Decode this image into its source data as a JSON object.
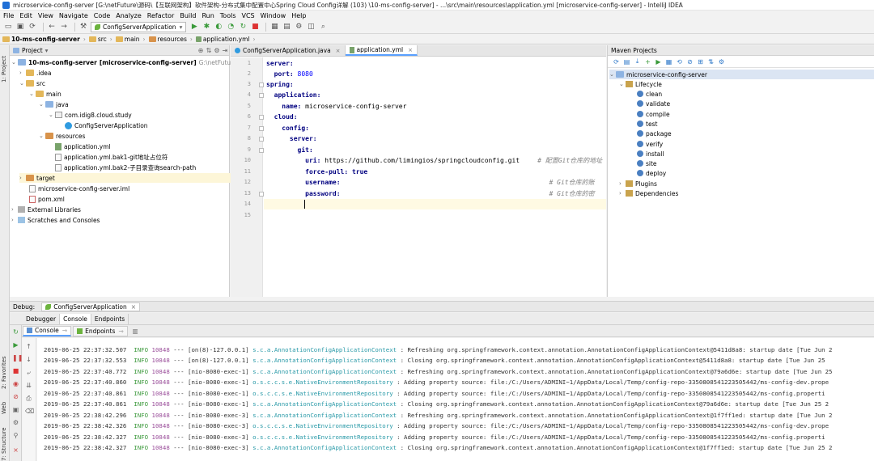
{
  "window": {
    "title": "microservice-config-server [G:\\netFuture\\源码\\【互联网架构】软件架构-分布式集中配置中心Spring Cloud Config详解 (103) \\10-ms-config-server] - ...\\src\\main\\resources\\application.yml [microservice-config-server] - IntelliJ IDEA"
  },
  "menu": [
    "File",
    "Edit",
    "View",
    "Navigate",
    "Code",
    "Analyze",
    "Refactor",
    "Build",
    "Run",
    "Tools",
    "VCS",
    "Window",
    "Help"
  ],
  "toolbar": {
    "run_config": "ConfigServerApplication"
  },
  "breadcrumb": [
    "10-ms-config-server",
    "src",
    "main",
    "resources",
    "application.yml"
  ],
  "left_strip": {
    "project_tab": "1: Project",
    "favorites_tab": "2: Favorites",
    "web_tab": "Web",
    "structure_tab": "7: Structure"
  },
  "project": {
    "title": "Project",
    "root_name": "10-ms-config-server",
    "root_module": "[microservice-config-server]",
    "root_path": "G:\\netFuture\\源码\\【互",
    "tree": {
      "idea": ".idea",
      "src": "src",
      "main": "main",
      "java": "java",
      "package": "com.idig8.cloud.study",
      "class": "ConfigServerApplication",
      "resources": "resources",
      "yml": "application.yml",
      "bak1": "application.yml.bak1-git地址占位符",
      "bak2": "application.yml.bak2-子目录查询search-path",
      "target": "target",
      "iml": "microservice-config-server.iml",
      "pom": "pom.xml",
      "libs": "External Libraries",
      "scratches": "Scratches and Consoles"
    }
  },
  "editor": {
    "tabs": [
      {
        "label": "ConfigServerApplication.java"
      },
      {
        "label": "application.yml"
      }
    ],
    "line_numbers": [
      "1",
      "2",
      "3",
      "4",
      "5",
      "6",
      "7",
      "8",
      "9",
      "10",
      "11",
      "12",
      "13",
      "14",
      "15"
    ],
    "code": {
      "l1": "server:",
      "l2k": "  port: ",
      "l2v": "8080",
      "l3": "spring:",
      "l4": "  application:",
      "l5k": "    name: ",
      "l5v": "microservice-config-server",
      "l6": "  cloud:",
      "l7": "    config:",
      "l8": "      server:",
      "l9": "        git:",
      "l10k": "          uri: ",
      "l10v": "https://github.com/limingios/springcloudconfig.git",
      "l10c": "# 配置Git仓库的地址",
      "l11k": "          force-pull: ",
      "l11v": "true",
      "l12k": "          username:",
      "l12c": "# Git仓库的账",
      "l13k": "          password:",
      "l13c": "# Git仓库的密"
    }
  },
  "maven": {
    "title": "Maven Projects",
    "project": "microservice-config-server",
    "lifecycle": "Lifecycle",
    "goals": [
      "clean",
      "validate",
      "compile",
      "test",
      "package",
      "verify",
      "install",
      "site",
      "deploy"
    ],
    "plugins": "Plugins",
    "dependencies": "Dependencies"
  },
  "debug": {
    "label": "Debug:",
    "session": "ConfigServerApplication",
    "subtabs": [
      "Debugger",
      "Console",
      "Endpoints"
    ],
    "console_tabs": [
      "Console",
      "Endpoints"
    ]
  },
  "logs": [
    {
      "ts": "2019-06-25 22:37:32.507",
      "lvl": "INFO",
      "pid": "10848",
      "thr": "--- [on(8)-127.0.0.1]",
      "cls": "s.c.a.AnnotationConfigApplicationContext",
      "msg": ": Refreshing org.springframework.context.annotation.AnnotationConfigApplicationContext@5411d8a8: startup date [Tue Jun 2"
    },
    {
      "ts": "2019-06-25 22:37:32.553",
      "lvl": "INFO",
      "pid": "10848",
      "thr": "--- [on(8)-127.0.0.1]",
      "cls": "s.c.a.AnnotationConfigApplicationContext",
      "msg": ": Closing org.springframework.context.annotation.AnnotationConfigApplicationContext@5411d8a8: startup date [Tue Jun 25"
    },
    {
      "ts": "2019-06-25 22:37:40.772",
      "lvl": "INFO",
      "pid": "10848",
      "thr": "--- [nio-8080-exec-1]",
      "cls": "s.c.a.AnnotationConfigApplicationContext",
      "msg": ": Refreshing org.springframework.context.annotation.AnnotationConfigApplicationContext@79a6d6e: startup date [Tue Jun 25"
    },
    {
      "ts": "2019-06-25 22:37:40.860",
      "lvl": "INFO",
      "pid": "10848",
      "thr": "--- [nio-8080-exec-1]",
      "cls": "o.s.c.c.s.e.NativeEnvironmentRepository",
      "msg": ": Adding property source: file:/C:/Users/ADMINI~1/AppData/Local/Temp/config-repo-3350808541223505442/ms-config-dev.prope"
    },
    {
      "ts": "2019-06-25 22:37:40.861",
      "lvl": "INFO",
      "pid": "10848",
      "thr": "--- [nio-8080-exec-1]",
      "cls": "o.s.c.c.s.e.NativeEnvironmentRepository",
      "msg": ": Adding property source: file:/C:/Users/ADMINI~1/AppData/Local/Temp/config-repo-3350808541223505442/ms-config.properti"
    },
    {
      "ts": "2019-06-25 22:37:40.861",
      "lvl": "INFO",
      "pid": "10848",
      "thr": "--- [nio-8080-exec-1]",
      "cls": "s.c.a.AnnotationConfigApplicationContext",
      "msg": ": Closing org.springframework.context.annotation.AnnotationConfigApplicationContext@79a6d6e: startup date [Tue Jun 25 2"
    },
    {
      "ts": "2019-06-25 22:38:42.296",
      "lvl": "INFO",
      "pid": "10848",
      "thr": "--- [nio-8080-exec-3]",
      "cls": "s.c.a.AnnotationConfigApplicationContext",
      "msg": ": Refreshing org.springframework.context.annotation.AnnotationConfigApplicationContext@1f7ff1ed: startup date [Tue Jun 2"
    },
    {
      "ts": "2019-06-25 22:38:42.326",
      "lvl": "INFO",
      "pid": "10848",
      "thr": "--- [nio-8080-exec-3]",
      "cls": "o.s.c.c.s.e.NativeEnvironmentRepository",
      "msg": ": Adding property source: file:/C:/Users/ADMINI~1/AppData/Local/Temp/config-repo-3350808541223505442/ms-config-dev.prope"
    },
    {
      "ts": "2019-06-25 22:38:42.327",
      "lvl": "INFO",
      "pid": "10848",
      "thr": "--- [nio-8080-exec-3]",
      "cls": "o.s.c.c.s.e.NativeEnvironmentRepository",
      "msg": ": Adding property source: file:/C:/Users/ADMINI~1/AppData/Local/Temp/config-repo-3350808541223505442/ms-config.properti"
    },
    {
      "ts": "2019-06-25 22:38:42.327",
      "lvl": "INFO",
      "pid": "10848",
      "thr": "--- [nio-8080-exec-3]",
      "cls": "s.c.a.AnnotationConfigApplicationContext",
      "msg": ": Closing org.springframework.context.annotation.AnnotationConfigApplicationContext@1f7ff1ed: startup date [Tue Jun 25 2"
    }
  ]
}
